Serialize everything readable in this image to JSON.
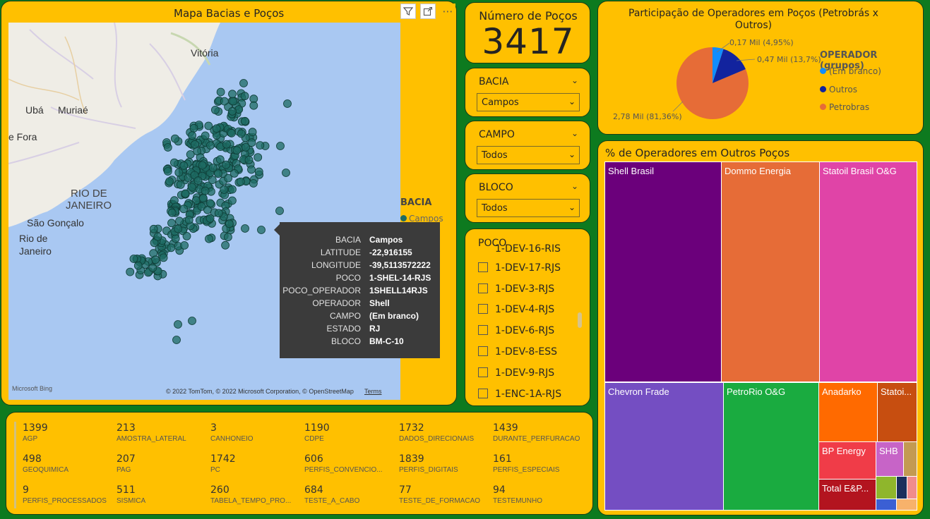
{
  "colors": {
    "background": "#0d7a1f",
    "card": "#ffc000",
    "tooltip": "#3b3b3b",
    "marker": "#1e6b63",
    "water": "#a9c8f2",
    "land": "#efede6"
  },
  "map": {
    "title": "Mapa Bacias e Poços",
    "header_icons": [
      "filter-icon",
      "focus-mode-icon",
      "more-options-icon"
    ],
    "places": {
      "vitoria": "Vitória",
      "uba": "Ubá",
      "muriae": "Muriaé",
      "juiz_de_fora": "e Fora",
      "rio_estado_1": "RIO DE",
      "rio_estado_2": "JANEIRO",
      "sao_goncalo": "São Gonçalo",
      "rio_cidade_1": "Rio de",
      "rio_cidade_2": "Janeiro"
    },
    "legend": {
      "title": "BACIA",
      "item": "Campos"
    },
    "bing_logo": "Microsoft Bing",
    "copyright": "© 2022 TomTom, © 2022 Microsoft Corporation, © OpenStreetMap",
    "terms": "Terms",
    "tooltip": [
      {
        "key": "BACIA",
        "value": "Campos"
      },
      {
        "key": "LATITUDE",
        "value": "-22,916155"
      },
      {
        "key": "LONGITUDE",
        "value": "-39,5113572222"
      },
      {
        "key": "POCO",
        "value": "1-SHEL-14-RJS"
      },
      {
        "key": "POCO_OPERADOR",
        "value": "1SHELL14RJS"
      },
      {
        "key": "OPERADOR",
        "value": "Shell"
      },
      {
        "key": "CAMPO",
        "value": "(Em branco)"
      },
      {
        "key": "ESTADO",
        "value": "RJ"
      },
      {
        "key": "BLOCO",
        "value": "BM-C-10"
      }
    ]
  },
  "count": {
    "title": "Número de Poços",
    "value": "3417"
  },
  "slicers": {
    "bacia": {
      "title": "BACIA",
      "value": "Campos"
    },
    "campo": {
      "title": "CAMPO",
      "value": "Todos"
    },
    "bloco": {
      "title": "BLOCO",
      "value": "Todos"
    }
  },
  "poco": {
    "title": "POCO",
    "partial_item": "1-DEV-16-RJS",
    "items": [
      "1-DEV-17-RJS",
      "1-DEV-3-RJS",
      "1-DEV-4-RJS",
      "1-DEV-6-RJS",
      "1-DEV-8-ESS",
      "1-DEV-9-RJS",
      "1-ENC-1A-RJS"
    ]
  },
  "pie": {
    "title": "Participação de Operadores em Poços (Petrobrás x Outros)",
    "legend_title": "OPERADOR (grupos)",
    "slices": [
      {
        "name": "(Em branco)",
        "label": "0,17 Mil (4,95%)",
        "value": 4.95,
        "color": "#118dff"
      },
      {
        "name": "Outros",
        "label": "0,47 Mil (13,7%)",
        "value": 13.7,
        "color": "#12239e"
      },
      {
        "name": "Petrobras",
        "label": "2,78 Mil (81,36%)",
        "value": 81.36,
        "color": "#e66c37"
      }
    ]
  },
  "treemap": {
    "title": "% de Operadores em Outros Poços",
    "tiles": [
      {
        "name": "Shell Brasil",
        "color": "#6b007b"
      },
      {
        "name": "Dommo Energia",
        "color": "#e66c37"
      },
      {
        "name": "Statoil Brasil O&G",
        "color": "#e044a7"
      },
      {
        "name": "Chevron Frade",
        "color": "#744ec2"
      },
      {
        "name": "PetroRio O&G",
        "color": "#1aab40"
      },
      {
        "name": "Anadarko",
        "color": "#ff6a00"
      },
      {
        "name": "Statoi...",
        "color": "#c74e10"
      },
      {
        "name": "BP Energy",
        "color": "#f03c48"
      },
      {
        "name": "SHB",
        "color": "#c764c7"
      },
      {
        "name": "Total E&P...",
        "color": "#b3141f"
      }
    ]
  },
  "stats": [
    {
      "value": "1399",
      "label": "AGP"
    },
    {
      "value": "213",
      "label": "AMOSTRA_LATERAL"
    },
    {
      "value": "3",
      "label": "CANHONEIO"
    },
    {
      "value": "1190",
      "label": "CDPE"
    },
    {
      "value": "1732",
      "label": "DADOS_DIRECIONAIS"
    },
    {
      "value": "1439",
      "label": "DURANTE_PERFURACAO"
    },
    {
      "value": "498",
      "label": "GEOQUIMICA"
    },
    {
      "value": "207",
      "label": "PAG"
    },
    {
      "value": "1742",
      "label": "PC"
    },
    {
      "value": "606",
      "label": "PERFIS_CONVENCIO..."
    },
    {
      "value": "1839",
      "label": "PERFIS_DIGITAIS"
    },
    {
      "value": "161",
      "label": "PERFIS_ESPECIAIS"
    },
    {
      "value": "9",
      "label": "PERFIS_PROCESSADOS"
    },
    {
      "value": "511",
      "label": "SISMICA"
    },
    {
      "value": "260",
      "label": "TABELA_TEMPO_PRO..."
    },
    {
      "value": "684",
      "label": "TESTE_A_CABO"
    },
    {
      "value": "77",
      "label": "TESTE_DE_FORMACAO"
    },
    {
      "value": "94",
      "label": "TESTEMUNHO"
    }
  ]
}
